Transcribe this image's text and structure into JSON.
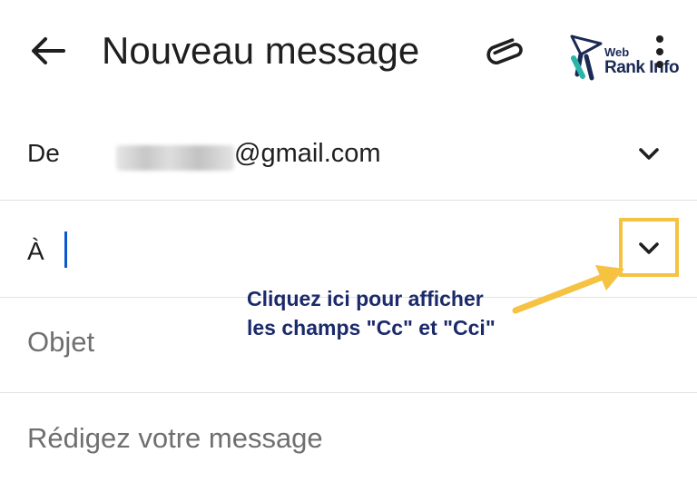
{
  "header": {
    "title": "Nouveau message",
    "back_icon": "arrow-left-icon",
    "attach_icon": "paperclip-icon",
    "more_icon": "more-vert-icon",
    "logo": {
      "line1": "Web",
      "line2": "Rank Info"
    }
  },
  "from": {
    "label": "De",
    "email_suffix": "@gmail.com",
    "dropdown_icon": "chevron-down-icon"
  },
  "to": {
    "label": "À",
    "dropdown_icon": "chevron-down-icon"
  },
  "subject": {
    "placeholder": "Objet"
  },
  "body": {
    "placeholder": "Rédigez votre message"
  },
  "annotation": {
    "line1": "Cliquez ici pour afficher",
    "line2": "les champs \"Cc\" et \"Cci\"",
    "highlight_color": "#f5c242",
    "text_color": "#1b2a6b"
  },
  "colors": {
    "caret": "#0b57d0"
  }
}
